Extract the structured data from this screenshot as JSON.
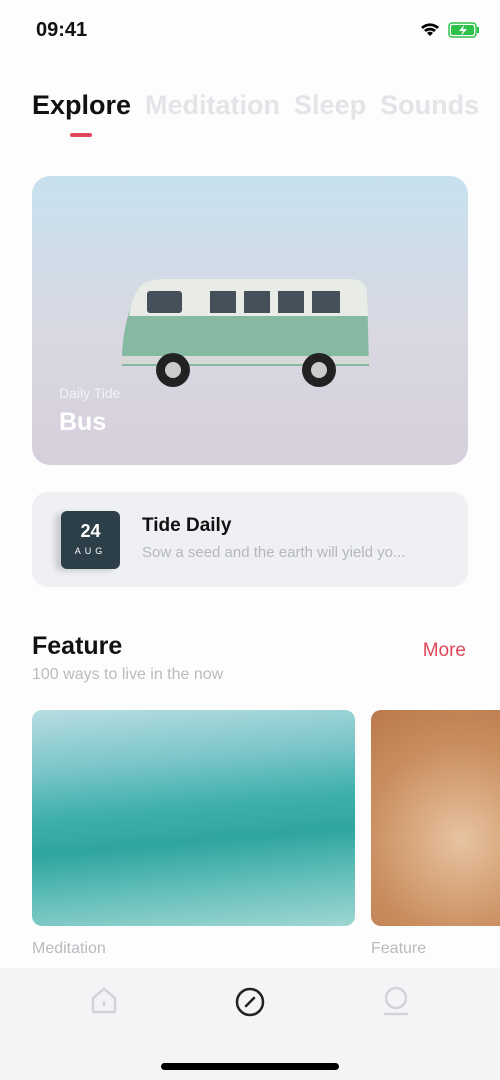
{
  "status": {
    "time": "09:41",
    "icons": [
      "wifi-icon",
      "battery-charging-icon"
    ],
    "battery_color": "#2ec14a"
  },
  "tabs": [
    {
      "label": "Explore",
      "active": true
    },
    {
      "label": "Meditation"
    },
    {
      "label": "Sleep"
    },
    {
      "label": "Sounds"
    }
  ],
  "accent": "#e0485a",
  "hero": {
    "subtitle": "Daily Tide",
    "title": "Bus"
  },
  "daily": {
    "day": "24",
    "month": "AUG",
    "title": "Tide Daily",
    "text": "Sow a seed and the earth will yield yo..."
  },
  "feature": {
    "title": "Feature",
    "subtitle": "100 ways to live in the now",
    "more": "More",
    "cards": [
      {
        "label": "Meditation"
      },
      {
        "label": "Feature"
      }
    ]
  },
  "nav": [
    {
      "icon": "home-icon"
    },
    {
      "icon": "compass-icon",
      "active": true
    },
    {
      "icon": "profile-icon"
    }
  ]
}
